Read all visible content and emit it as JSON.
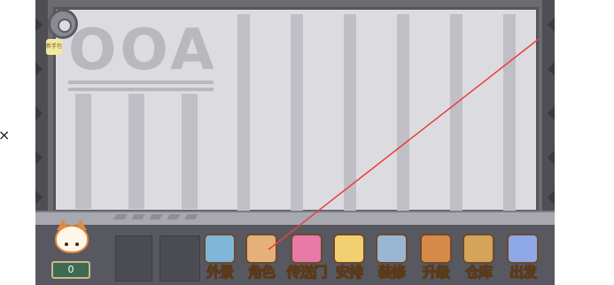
{
  "overlay": {
    "close_glyph": "×"
  },
  "scene": {
    "door_label": "OOA",
    "settings_tag": "新手包"
  },
  "player": {
    "coins": "0"
  },
  "menu": [
    {
      "id": "appearance",
      "label": "外景",
      "icon": "landscape-map-icon",
      "color": "#7fb6d9"
    },
    {
      "id": "character",
      "label": "角色",
      "icon": "character-photo-icon",
      "color": "#e6b07a"
    },
    {
      "id": "portal",
      "label": "传送门",
      "icon": "pink-door-icon",
      "color": "#e77aa6"
    },
    {
      "id": "arrange",
      "label": "安排",
      "icon": "clipboard-schedule-icon",
      "color": "#f2cf70"
    },
    {
      "id": "renovate",
      "label": "装修",
      "icon": "hammer-brush-icon",
      "color": "#9ab6d2"
    },
    {
      "id": "upgrade",
      "label": "升级",
      "icon": "hammer-upgrade-icon",
      "color": "#d68a4a"
    },
    {
      "id": "storage",
      "label": "仓库",
      "icon": "storage-box-icon",
      "color": "#d4a45a"
    },
    {
      "id": "depart",
      "label": "出发",
      "icon": "rocket-flag-icon",
      "color": "#8fa9e8"
    }
  ],
  "colors": {
    "frame": "#6b6b70",
    "door": "#dcdce0",
    "annotation_line": "#e84040"
  }
}
